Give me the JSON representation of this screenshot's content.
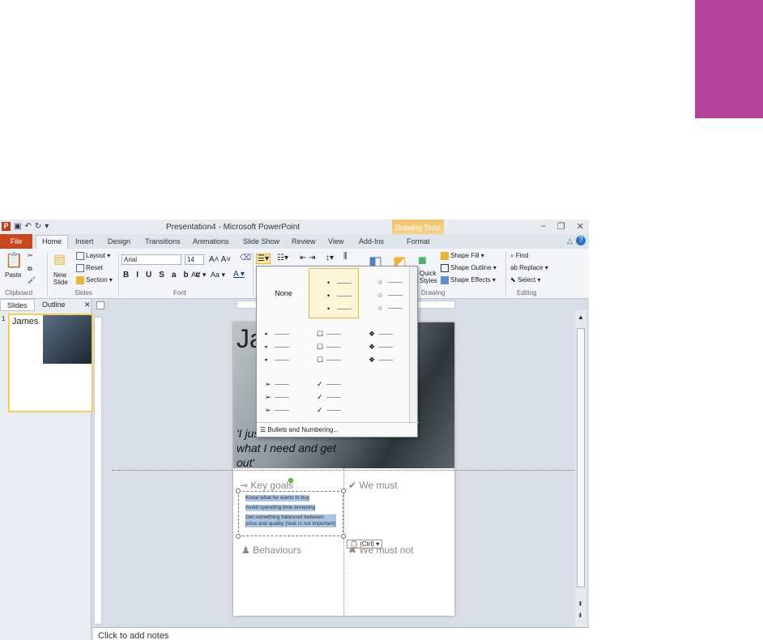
{
  "accent_pink": "#b4449a",
  "window": {
    "title": "Presentation4 - Microsoft PowerPoint",
    "context_tab_group": "Drawing Tools"
  },
  "tabs": [
    "File",
    "Home",
    "Insert",
    "Design",
    "Transitions",
    "Animations",
    "Slide Show",
    "Review",
    "View",
    "Add-Ins",
    "Format"
  ],
  "ribbon": {
    "paste": "Paste",
    "new_slide": "New\nSlide",
    "layout": "Layout",
    "reset": "Reset",
    "section": "Section",
    "font_name": "Arial",
    "font_size": "14",
    "quick_styles": "Quick\nStyles",
    "shape_fill": "Shape Fill",
    "shape_outline": "Shape Outline",
    "shape_effects": "Shape Effects",
    "find": "Find",
    "replace": "Replace",
    "select": "Select",
    "groups": {
      "clipboard": "Clipboard",
      "slides": "Slides",
      "font": "Font",
      "drawing": "Drawing",
      "editing": "Editing"
    }
  },
  "pane": {
    "tab_slides": "Slides",
    "tab_outline": "Outline",
    "slide_number": "1",
    "thumb_title": "James"
  },
  "slide": {
    "title": "James",
    "quote_lines": [
      "'I just",
      "what I need and get",
      "out'"
    ],
    "labels": {
      "key_goals": "Key goals",
      "we_must": "We must",
      "behaviours": "Behaviours",
      "we_must_not": "We must not"
    },
    "bullets": [
      "Know what he wants to buy",
      "Avoid spending time browsing",
      "Get something balanced between price and quality (look is not important)"
    ]
  },
  "ctrl_tag": "(Ctrl)",
  "bullets_gallery": {
    "none_label": "None",
    "footer": "Bullets and Numbering...",
    "markers": [
      "•",
      "○",
      "▪",
      "☐",
      "❖",
      "➢",
      "✓"
    ]
  },
  "notes": "Click to add notes"
}
